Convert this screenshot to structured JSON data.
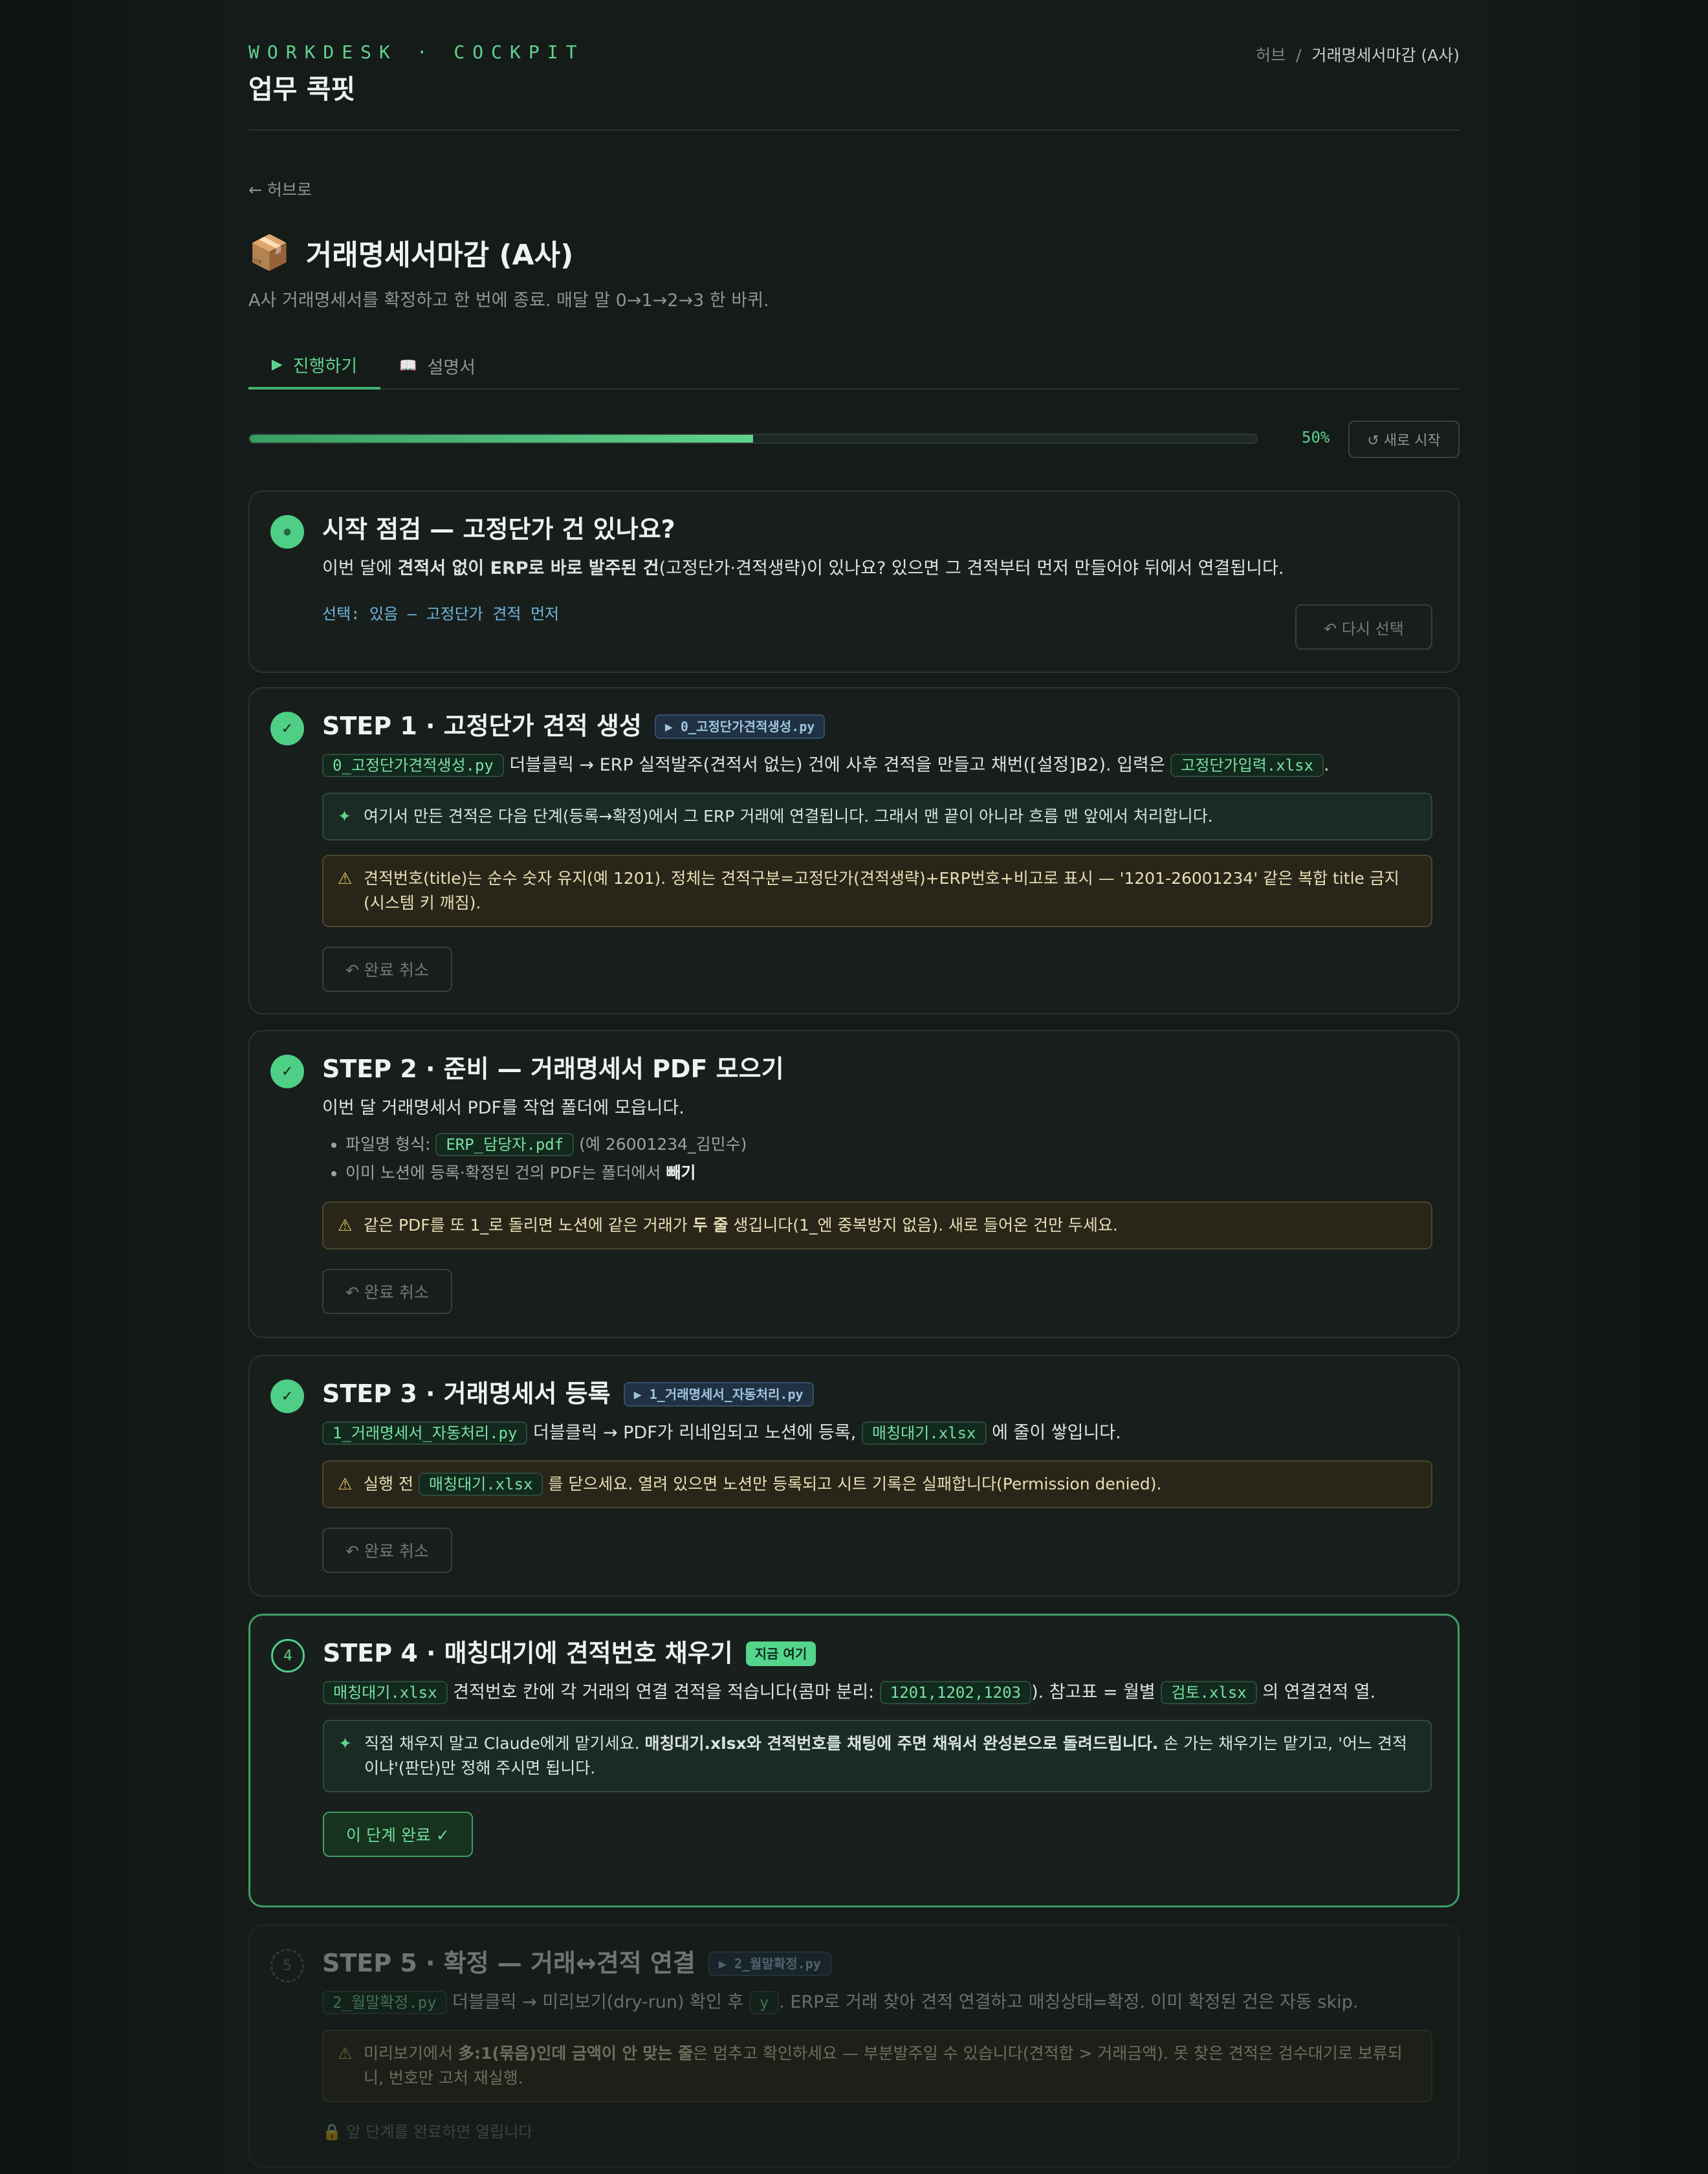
{
  "header": {
    "brand": "WORKDESK · COCKPIT",
    "app_title": "업무 콕핏",
    "crumb_home": "허브",
    "crumb_sep": "/",
    "crumb_current": "거래명세서마감 (A사)"
  },
  "back_link": "← 허브로",
  "page": {
    "emoji": "📦",
    "title": "거래명세서마감 (A사)",
    "description": "A사 거래명세서를 확정하고 한 번에 종료. 매달 말 0→1→2→3 한 바퀴."
  },
  "tabs": [
    {
      "icon": "▶",
      "label": "진행하기"
    },
    {
      "icon": "📖",
      "label": "설명서"
    }
  ],
  "progress": {
    "value": 0.5,
    "label": "50%",
    "restart_label": "↺ 새로 시작"
  },
  "colors": {
    "accent": "#5fd38d",
    "background": "#151b19",
    "warning": "#e6c560"
  },
  "check": {
    "title": "시작 점검 — 고정단가 건 있나요?",
    "text_a": "이번 달에 ",
    "text_bold": "견적서 없이 ERP로 바로 발주된 건",
    "text_b": "(고정단가·견적생략)이 있나요? 있으면 그 견적부터 먼저 만들어야 뒤에서 연결됩니다.",
    "choice": "선택: 있음 — 고정단가 견적 먼저",
    "reselect": "↶ 다시 선택"
  },
  "step1": {
    "badge": "✓",
    "title": "STEP 1 · 고정단가 견적 생성",
    "tag": "▶ 0_고정단가견적생성.py",
    "code_a": "0_고정단가견적생성.py",
    "text_a": " 더블클릭 → ERP 실적발주(견적서 없는) 건에 사후 견적을 만들고 채번([설정]B2). 입력은 ",
    "code_b": "고정단가입력.xlsx",
    "text_b": ".",
    "tip_icon": "✦",
    "tip": "여기서 만든 견적은 다음 단계(등록→확정)에서 그 ERP 거래에 연결됩니다. 그래서 맨 끝이 아니라 흐름 맨 앞에서 처리합니다.",
    "warn_icon": "⚠",
    "warn": "견적번호(title)는 순수 숫자 유지(예 1201). 정체는 견적구분=고정단가(견적생략)+ERP번호+비고로 표시 — '1201-26001234' 같은 복합 title 금지(시스템 키 깨짐).",
    "undo": "↶ 완료 취소"
  },
  "step2": {
    "badge": "✓",
    "title": "STEP 2 · 준비 — 거래명세서 PDF 모으기",
    "text": "이번 달 거래명세서 PDF를 작업 폴더에 모읍니다.",
    "li1_a": "파일명 형식: ",
    "li1_code": "ERP_담당자.pdf",
    "li1_b": " (예 26001234_김민수)",
    "li2_a": "이미 노션에 등록·확정된 건의 PDF는 폴더에서 ",
    "li2_bold": "빼기",
    "warn_icon": "⚠",
    "warn_a": "같은 PDF를 또 1_로 돌리면 노션에 같은 거래가 ",
    "warn_bold": "두 줄",
    "warn_b": " 생깁니다(1_엔 중복방지 없음). 새로 들어온 건만 두세요.",
    "undo": "↶ 완료 취소"
  },
  "step3": {
    "badge": "✓",
    "title": "STEP 3 · 거래명세서 등록",
    "tag": "▶ 1_거래명세서_자동처리.py",
    "code_a": "1_거래명세서_자동처리.py",
    "text_a": " 더블클릭 → PDF가 리네임되고 노션에 등록, ",
    "code_b": "매칭대기.xlsx",
    "text_b": " 에 줄이 쌓입니다.",
    "warn_icon": "⚠",
    "warn_a": "실행 전 ",
    "warn_code": "매칭대기.xlsx",
    "warn_b": " 를 닫으세요. 열려 있으면 노션만 등록되고 시트 기록은 실패합니다(Permission denied).",
    "undo": "↶ 완료 취소"
  },
  "step4": {
    "badge": "4",
    "title": "STEP 4 · 매칭대기에 견적번호 채우기",
    "tag": "지금 여기",
    "code_a": "매칭대기.xlsx",
    "text_a": " 견적번호 칸에 각 거래의 연결 견적을 적습니다(콤마 분리: ",
    "code_b": "1201,1202,1203",
    "text_b": "). 참고표 = 월별 ",
    "code_c": "검토.xlsx",
    "text_c": " 의 연결견적 열.",
    "tip_icon": "✦",
    "tip_a": "직접 채우지 말고 Claude에게 맡기세요. ",
    "tip_bold": "매칭대기.xlsx와 견적번호를 채팅에 주면 채워서 완성본으로 돌려드립니다.",
    "tip_b": " 손 가는 채우기는 맡기고, '어느 견적이냐'(판단)만 정해 주시면 됩니다.",
    "complete": "이 단계 완료 ✓"
  },
  "step5": {
    "badge": "5",
    "title": "STEP 5 · 확정 — 거래↔견적 연결",
    "tag": "▶ 2_월말확정.py",
    "code_a": "2_월말확정.py",
    "text_a": " 더블클릭 → 미리보기(dry-run) 확인 후 ",
    "code_b": "y",
    "text_b": ". ERP로 거래 찾아 견적 연결하고 매칭상태=확정. 이미 확정된 건은 자동 skip.",
    "warn_icon": "⚠",
    "warn_a": "미리보기에서 ",
    "warn_bold": "多:1(묶음)인데 금액이 안 맞는 줄",
    "warn_b": "은 멈추고 확인하세요 — 부분발주일 수 있습니다(견적합 > 거래금액). 못 찾은 견적은 검수대기로 보류되니, 번호만 고처 재실행.",
    "locked": "🔒 앞 단계를 완료하면 열립니다"
  }
}
